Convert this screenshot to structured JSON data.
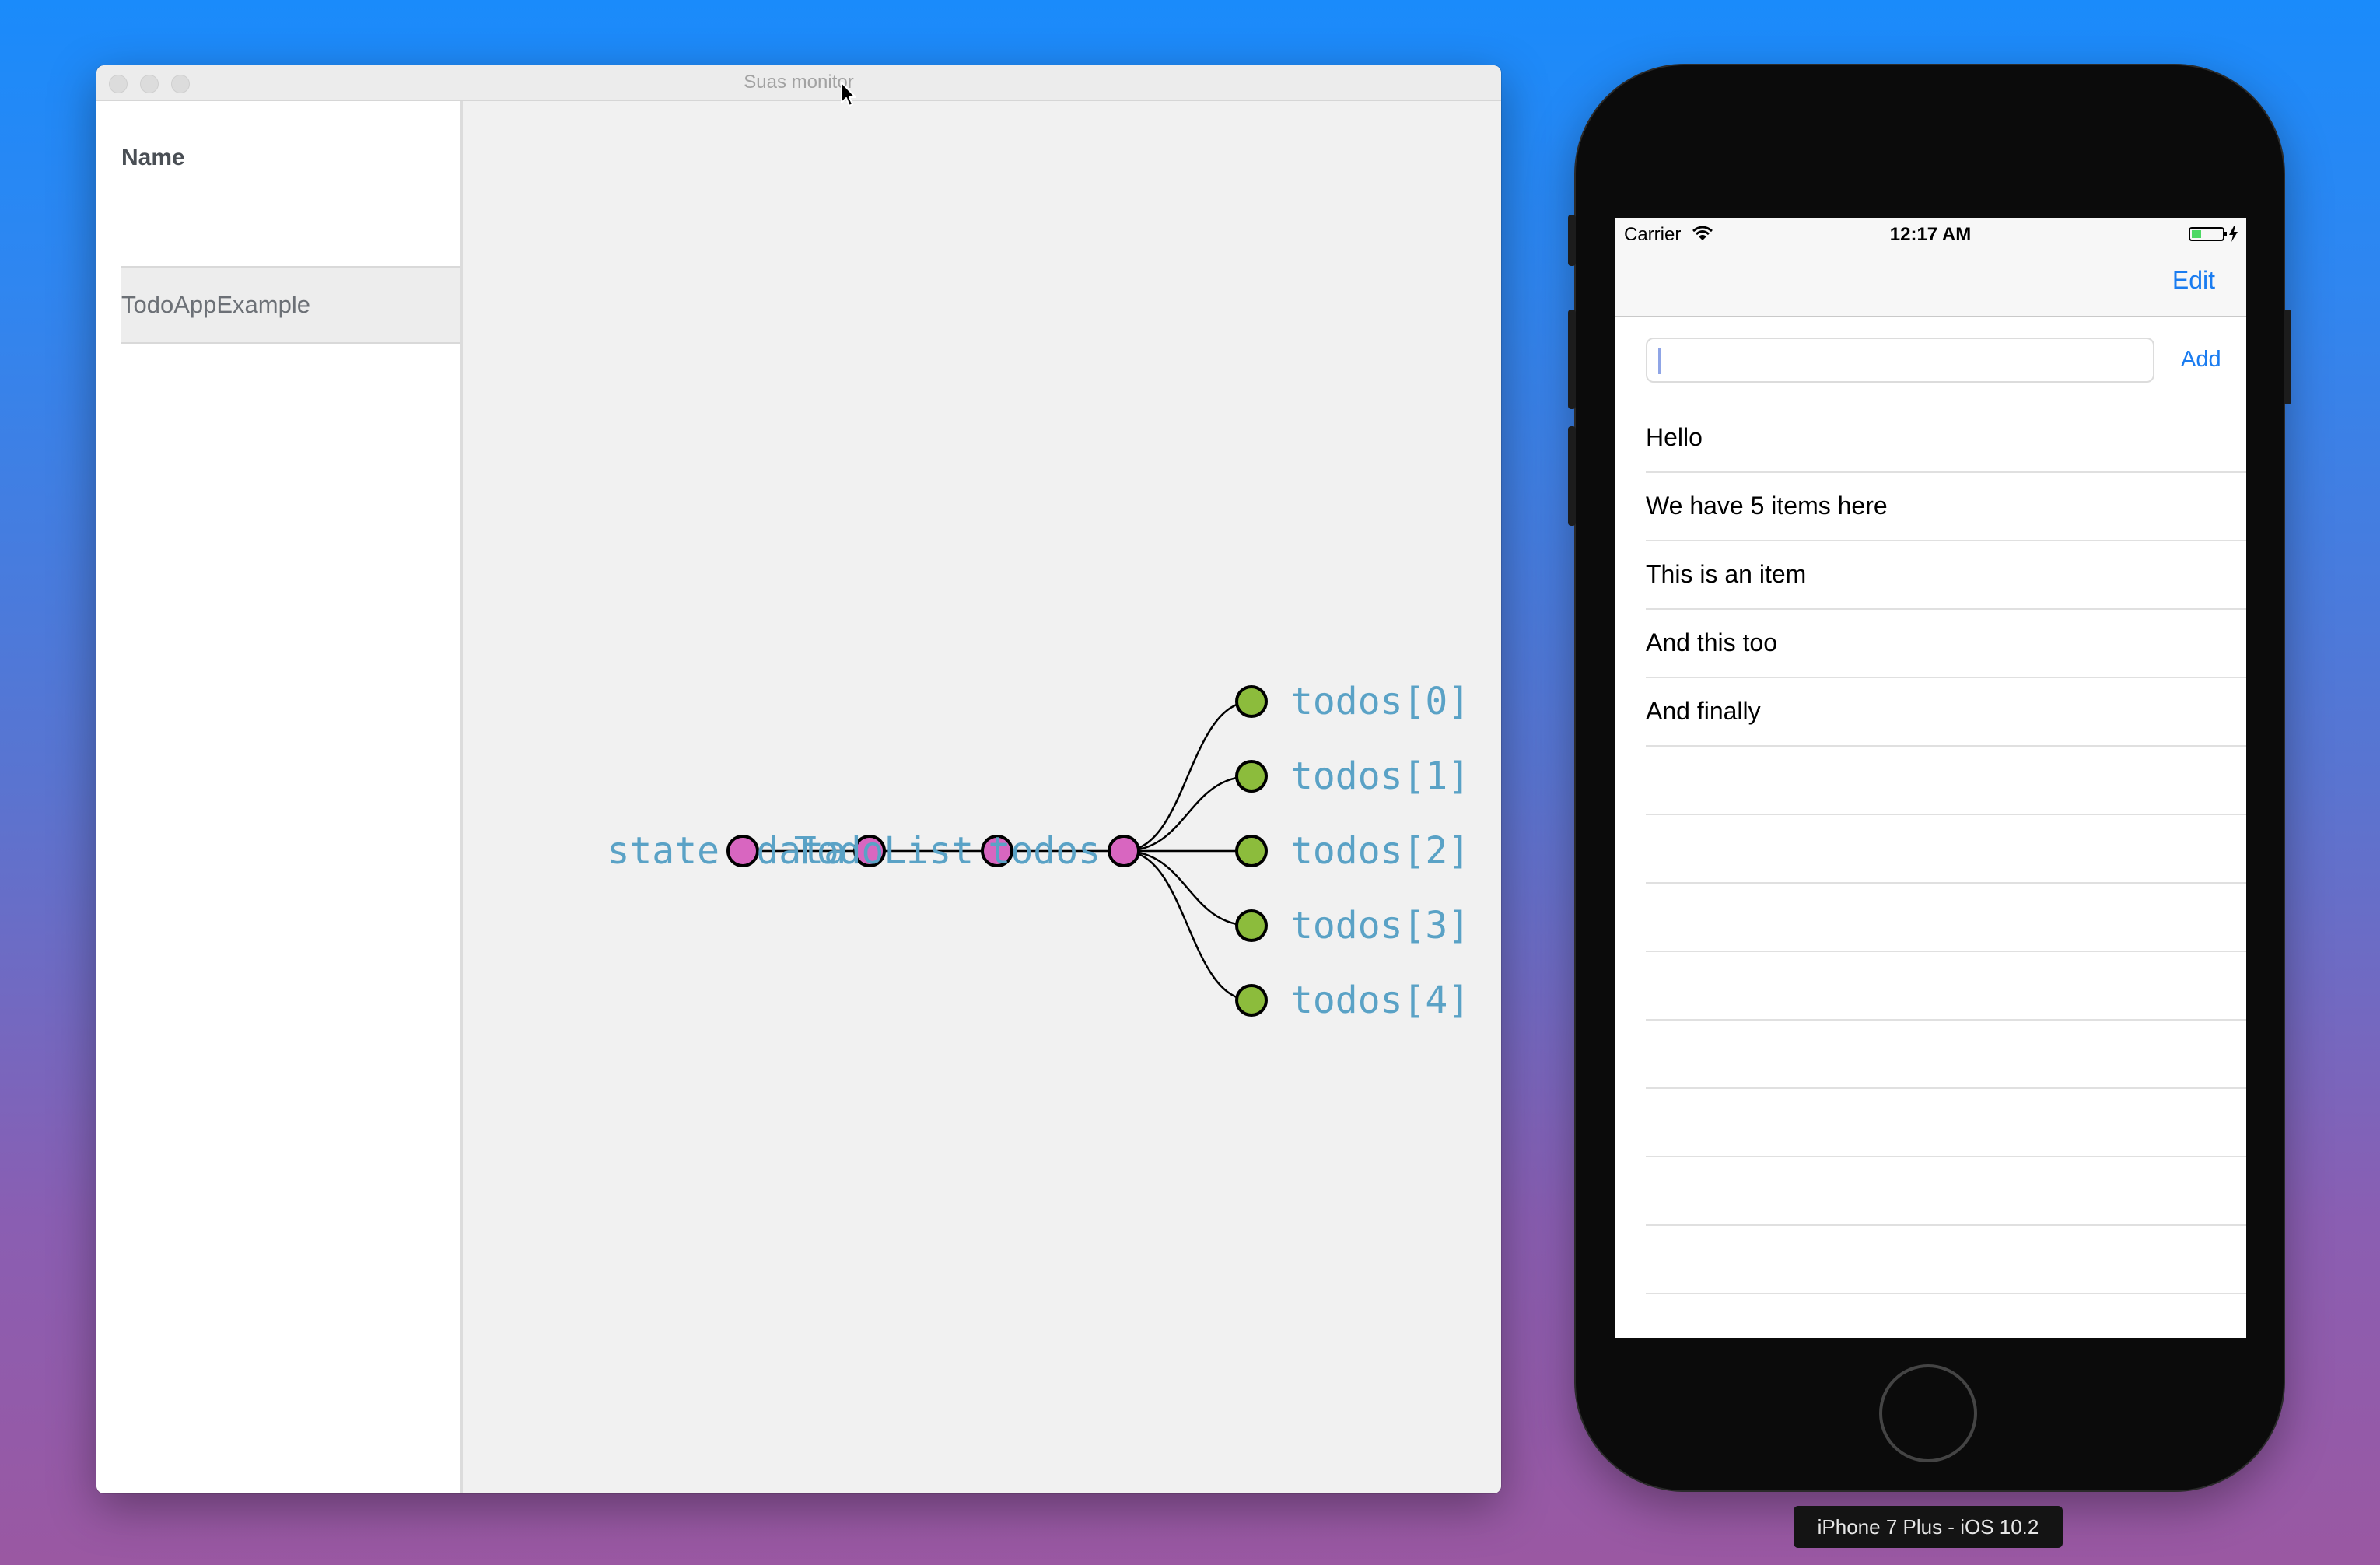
{
  "window": {
    "title": "Suas monitor"
  },
  "sidebar": {
    "header": "Name",
    "items": [
      {
        "label": "TodoAppExample"
      }
    ]
  },
  "graph": {
    "nodes": [
      {
        "label": "state",
        "color": "#d866c0"
      },
      {
        "label": "data",
        "color": "#d866c0"
      },
      {
        "label": "TodoList",
        "color": "#d866c0"
      },
      {
        "label": "todos",
        "color": "#d866c0"
      },
      {
        "label": "todos[0]",
        "color": "#8cbc3c"
      },
      {
        "label": "todos[1]",
        "color": "#8cbc3c"
      },
      {
        "label": "todos[2]",
        "color": "#8cbc3c"
      },
      {
        "label": "todos[3]",
        "color": "#8cbc3c"
      },
      {
        "label": "todos[4]",
        "color": "#8cbc3c"
      }
    ],
    "label_color": "#5aa2c6",
    "branch_color": "#d866c0",
    "leaf_color": "#8cbc3c"
  },
  "phone": {
    "status": {
      "carrier": "Carrier",
      "time": "12:17 AM"
    },
    "nav": {
      "edit_label": "Edit"
    },
    "input": {
      "value": "",
      "add_label": "Add"
    },
    "todos": [
      {
        "label": "Hello"
      },
      {
        "label": "We have 5 items here"
      },
      {
        "label": "This is an item"
      },
      {
        "label": "And this too"
      },
      {
        "label": "And finally"
      }
    ],
    "empty_rows": 8,
    "device_label": "iPhone 7 Plus - iOS 10.2",
    "accent_color": "#1a7cf0"
  }
}
